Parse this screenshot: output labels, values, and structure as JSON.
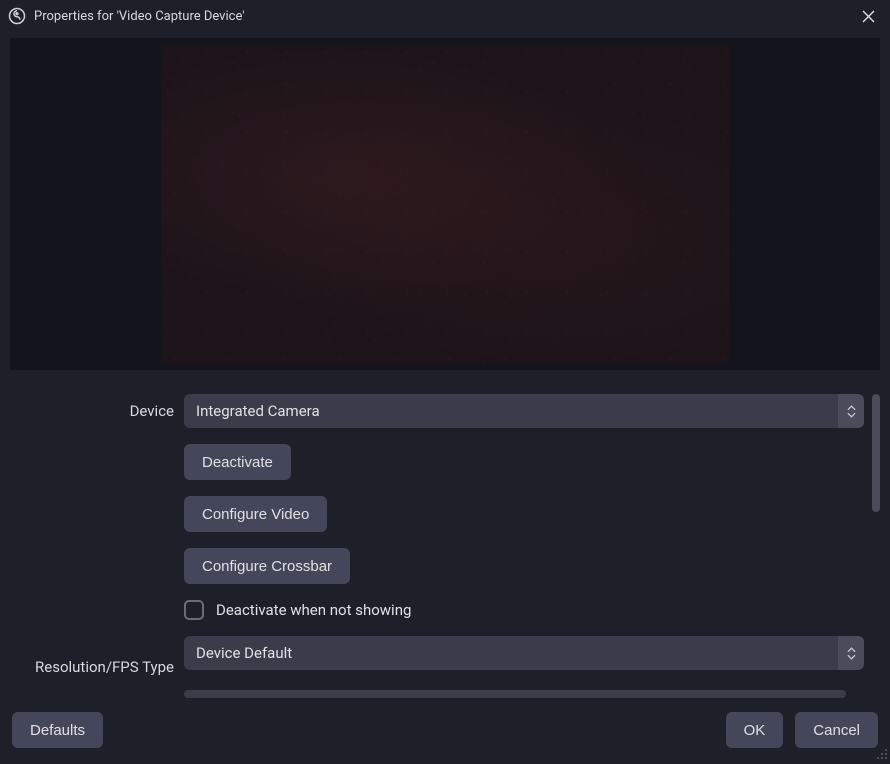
{
  "titlebar": {
    "title": "Properties for 'Video Capture Device'"
  },
  "form": {
    "device_label": "Device",
    "device_value": "Integrated Camera",
    "deactivate_button": "Deactivate",
    "configure_video_button": "Configure Video",
    "configure_crossbar_button": "Configure Crossbar",
    "deactivate_when_not_showing_label": "Deactivate when not showing",
    "resolution_fps_type_label": "Resolution/FPS Type",
    "resolution_fps_type_value": "Device Default"
  },
  "buttons": {
    "defaults": "Defaults",
    "ok": "OK",
    "cancel": "Cancel"
  }
}
